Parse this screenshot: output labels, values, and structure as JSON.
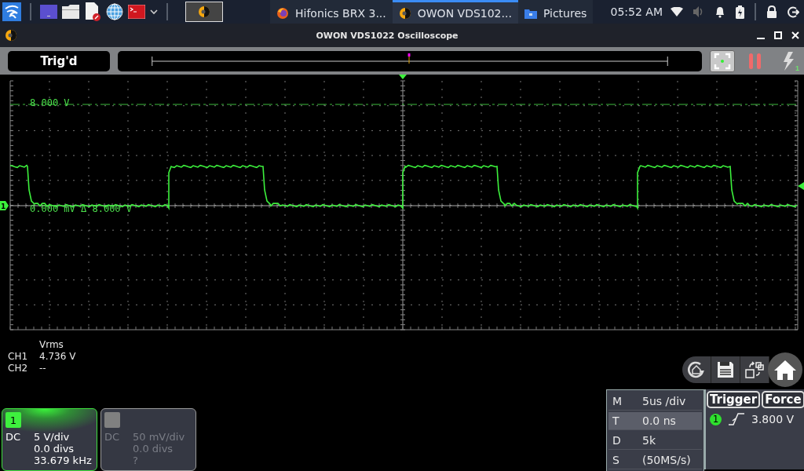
{
  "taskbar": {
    "tasks": [
      {
        "label": "Hifonics BRX 3...",
        "kind": "browser",
        "selected": false
      },
      {
        "label": "OWON VDS102...",
        "kind": "scope",
        "selected": true
      },
      {
        "label": "Pictures",
        "kind": "folder",
        "selected": false
      }
    ],
    "clock": "05:52 AM"
  },
  "window": {
    "title": "OWON VDS1022 Oscilloscope"
  },
  "toolbar": {
    "status": "Trig'd",
    "auto_channel": "1"
  },
  "scope": {
    "cursor_label": "8.000 V",
    "ground_label": "0.000 mV Δ 8.000 V",
    "channel_marker": "1"
  },
  "measurements": {
    "header": "Vrms",
    "rows": [
      {
        "channel": "CH1",
        "value": "4.736 V"
      },
      {
        "channel": "CH2",
        "value": "--"
      }
    ]
  },
  "channels": [
    {
      "number": "1",
      "on": true,
      "coupling": "DC",
      "scale": "5 V/div",
      "offset": "0.0 divs",
      "frequency": "33.679 kHz"
    },
    {
      "on": false,
      "coupling": "DC",
      "scale": "50 mV/div",
      "offset": "0.0 divs",
      "frequency": "?"
    }
  ],
  "horizontal": {
    "rows": [
      {
        "key": "M",
        "value": "5us /div",
        "selected": false
      },
      {
        "key": "T",
        "value": "0.0 ns",
        "selected": true
      },
      {
        "key": "D",
        "value": "5k",
        "selected": false
      },
      {
        "key": "S",
        "value": "(50MS/s)",
        "selected": false
      }
    ]
  },
  "trigger": {
    "buttons": [
      "Trigger",
      "Force"
    ],
    "source": "1",
    "level": "3.800 V"
  }
}
